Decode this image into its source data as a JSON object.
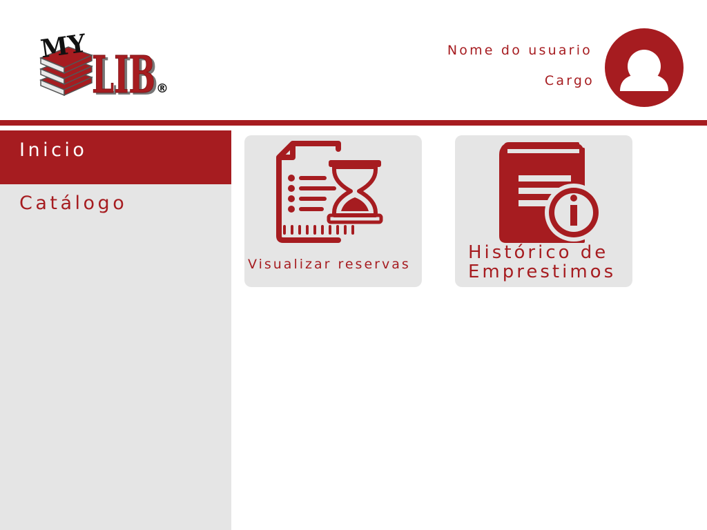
{
  "header": {
    "logo": {
      "top_text": "MY",
      "main_text": "LIB",
      "registered_mark": "®"
    },
    "user": {
      "name": "Nome do usuario",
      "role": "Cargo",
      "avatar_icon": "user-avatar-icon"
    }
  },
  "sidebar": {
    "items": [
      {
        "label": "Inicio",
        "active": true
      },
      {
        "label": "Catálogo",
        "active": false
      }
    ]
  },
  "cards": [
    {
      "label": "Visualizar reservas",
      "icon": "document-hourglass-icon"
    },
    {
      "label": "Histórico de\nEmprestimos",
      "icon": "book-info-icon"
    }
  ],
  "colors": {
    "brand": "#a61c20",
    "panel": "#e5e5e5",
    "background": "#ffffff"
  }
}
